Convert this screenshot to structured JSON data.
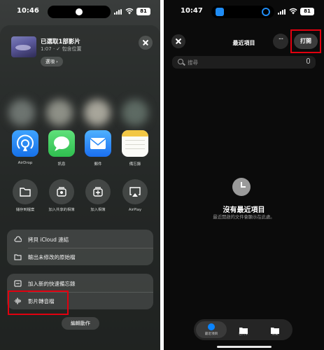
{
  "left_screen": {
    "status": {
      "time": "10:46",
      "battery": "81"
    },
    "share_sheet": {
      "title": "已選取1部影片",
      "subtitle": "1:07 · ✓ 包含位置",
      "options_label": "選項",
      "apps": [
        {
          "label": "AirDrop",
          "icon": "airdrop-icon",
          "color": "#1e8bf5"
        },
        {
          "label": "訊息",
          "icon": "messages-icon",
          "color": "#34c759"
        },
        {
          "label": "郵件",
          "icon": "mail-icon",
          "color": "#2f8cf7"
        },
        {
          "label": "備忘錄",
          "icon": "notes-icon",
          "color": "#f2c744"
        }
      ],
      "actions": [
        {
          "label": "儲存到檔案",
          "icon": "folder-icon"
        },
        {
          "label": "加入共享的相簿",
          "icon": "shared-album-icon"
        },
        {
          "label": "加入相簿",
          "icon": "add-album-icon"
        },
        {
          "label": "AirPlay",
          "icon": "airplay-icon"
        }
      ],
      "group1": [
        {
          "label": "拷貝 iCloud 連結",
          "icon": "cloud-link-icon"
        },
        {
          "label": "輸出未修改的原始檔",
          "icon": "folder-icon"
        }
      ],
      "group2": [
        {
          "label": "加入新的快速備忘錄",
          "icon": "quick-note-icon"
        },
        {
          "label": "影片轉音檔",
          "icon": "waveform-icon"
        }
      ],
      "edit_actions_label": "編輯動作"
    }
  },
  "right_screen": {
    "status": {
      "time": "10:47",
      "battery": "81"
    },
    "nav": {
      "title": "最近項目",
      "open_label": "打開",
      "more_label": "···"
    },
    "search": {
      "placeholder": "搜尋"
    },
    "empty_state": {
      "title": "沒有最近項目",
      "subtitle": "最近開啟的文件會顯示在此處。"
    },
    "tabs": [
      {
        "label": "最近項目",
        "icon": "clock-icon"
      },
      {
        "label": "已共享",
        "icon": "shared-folder-icon"
      },
      {
        "label": "瀏覽",
        "icon": "folder-icon"
      }
    ]
  },
  "colors": {
    "highlight": "#e1000f",
    "accent": "#0a84ff"
  }
}
